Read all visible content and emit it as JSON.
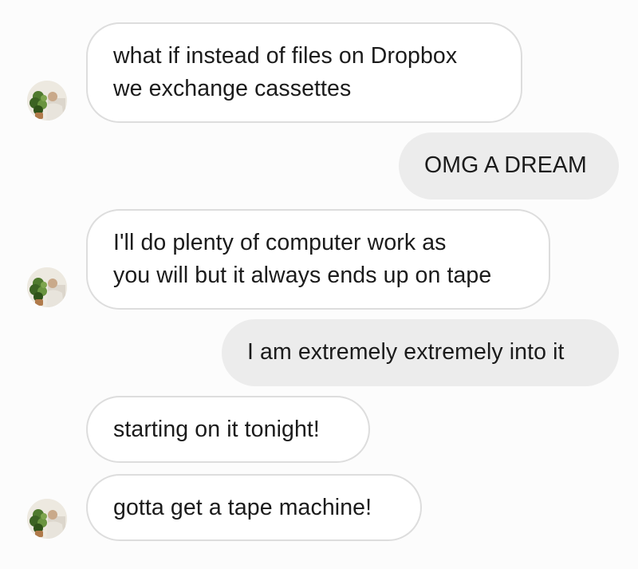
{
  "thread": {
    "messages": [
      {
        "direction": "incoming",
        "lines": [
          "what if instead of files on Dropbox",
          "we exchange cassettes"
        ]
      },
      {
        "direction": "outgoing",
        "lines": [
          "OMG A DREAM"
        ]
      },
      {
        "direction": "incoming",
        "lines": [
          "I'll do plenty of computer work as",
          "you will but it always ends up on tape"
        ]
      },
      {
        "direction": "outgoing",
        "lines": [
          "I am extremely extremely into it"
        ]
      },
      {
        "direction": "incoming",
        "lines": [
          "starting on it tonight!"
        ]
      },
      {
        "direction": "incoming",
        "lines": [
          "gotta get a tape machine!"
        ]
      }
    ]
  },
  "avatar": {
    "icon": "profile-photo-avatar"
  },
  "colors": {
    "incoming_bubble_bg": "#ffffff",
    "incoming_bubble_border": "#dddddd",
    "outgoing_bubble_bg": "#ececec",
    "text": "#1b1b1b",
    "background": "#fcfcfc"
  }
}
